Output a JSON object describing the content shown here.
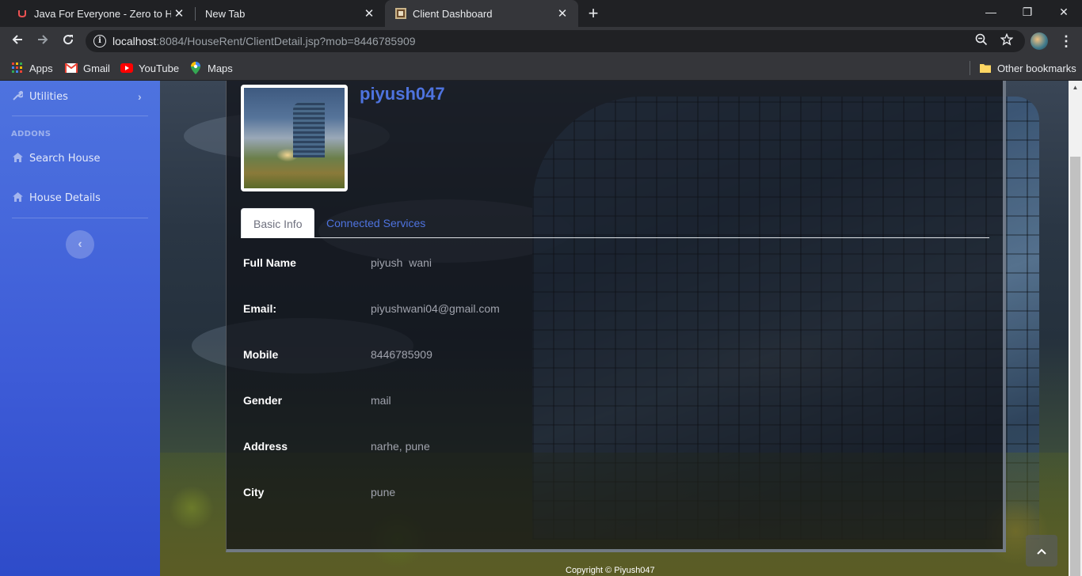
{
  "browser": {
    "tabs": [
      {
        "title": "Java For Everyone - Zero to Hero",
        "close": "✕"
      },
      {
        "title": "New Tab",
        "close": "✕"
      },
      {
        "title": "Client Dashboard",
        "close": "✕"
      }
    ],
    "new_tab": "+",
    "window_controls": {
      "minimize": "—",
      "restore": "❐",
      "close": "✕"
    },
    "url": {
      "host": "localhost",
      "rest": ":8084/HouseRent/ClientDetail.jsp?mob=8446785909"
    },
    "bookmarks": [
      {
        "label": "Apps",
        "icon": "apps-grid-icon"
      },
      {
        "label": "Gmail",
        "icon": "gmail-icon"
      },
      {
        "label": "YouTube",
        "icon": "youtube-icon"
      },
      {
        "label": "Maps",
        "icon": "maps-icon"
      }
    ],
    "other_bookmarks": "Other bookmarks"
  },
  "sidebar": {
    "utilities": "Utilities",
    "addons_heading": "ADDONS",
    "items": [
      {
        "label": "Search House",
        "icon": "home-icon"
      },
      {
        "label": "House Details",
        "icon": "home-icon"
      }
    ],
    "toggle": "‹"
  },
  "profile": {
    "username": "piyush047",
    "tabs": {
      "basic_info": "Basic Info",
      "connected_services": "Connected Services"
    },
    "fields": [
      {
        "label": "Full Name",
        "value": "piyush  wani"
      },
      {
        "label": "Email:",
        "value": "piyushwani04@gmail.com"
      },
      {
        "label": "Mobile",
        "value": "8446785909"
      },
      {
        "label": "Gender",
        "value": "mail"
      },
      {
        "label": "Address",
        "value": "narhe, pune"
      },
      {
        "label": "City",
        "value": "pune"
      }
    ]
  },
  "footer": {
    "copyright": "Copyright © Piyush047"
  },
  "colors": {
    "primary": "#4e73df",
    "sidebar_bottom": "#2e4bc9",
    "chrome_dark": "#202124",
    "chrome_toolbar": "#35363a"
  }
}
